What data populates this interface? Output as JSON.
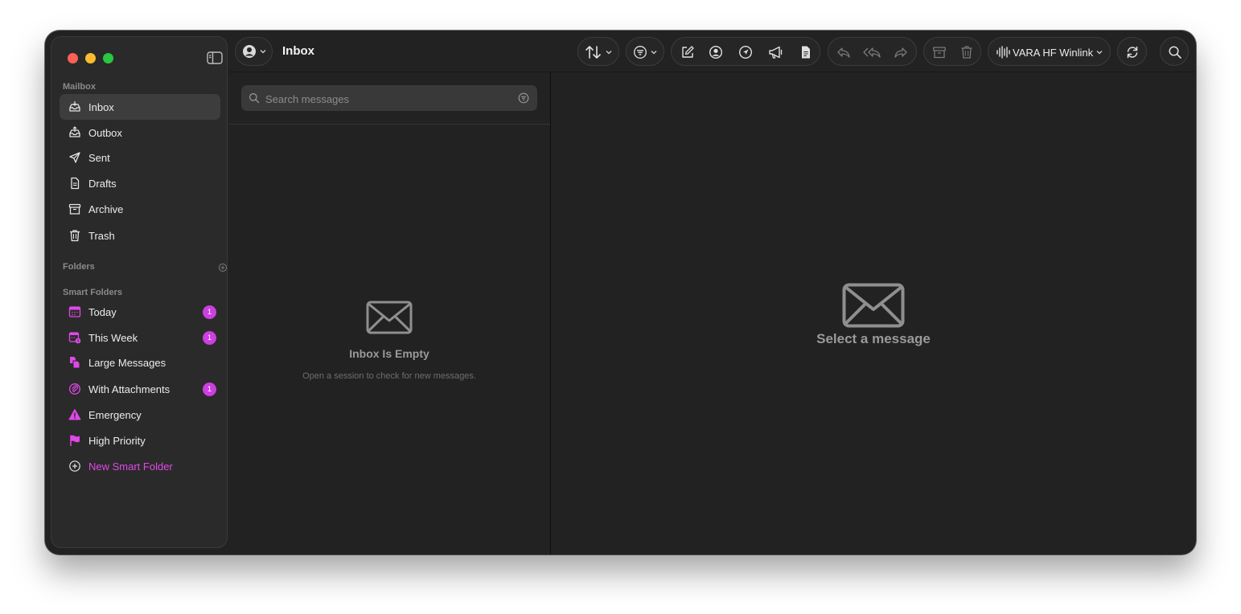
{
  "window": {
    "title": "Inbox",
    "accent_color": "#e048e8",
    "badge_color": "#cc3fe0"
  },
  "sidebar": {
    "mailbox_label": "Mailbox",
    "mailbox_items": [
      {
        "label": "Inbox",
        "icon": "inbox-icon",
        "selected": true
      },
      {
        "label": "Outbox",
        "icon": "outbox-icon"
      },
      {
        "label": "Sent",
        "icon": "paper-plane-icon"
      },
      {
        "label": "Drafts",
        "icon": "document-icon"
      },
      {
        "label": "Archive",
        "icon": "archive-box-icon"
      },
      {
        "label": "Trash",
        "icon": "trash-icon"
      }
    ],
    "folders_label": "Folders",
    "smart_folders_label": "Smart Folders",
    "smart_items": [
      {
        "label": "Today",
        "icon": "calendar-icon",
        "badge": "1"
      },
      {
        "label": "This Week",
        "icon": "calendar-week-icon",
        "badge": "1"
      },
      {
        "label": "Large Messages",
        "icon": "large-docs-icon"
      },
      {
        "label": "With Attachments",
        "icon": "paperclip-icon",
        "badge": "1"
      },
      {
        "label": "Emergency",
        "icon": "warning-triangle-icon"
      },
      {
        "label": "High Priority",
        "icon": "flag-icon"
      },
      {
        "label": "New Smart Folder",
        "icon": "plus-circle-icon"
      }
    ]
  },
  "toolbar": {
    "modem_label": "VARA HF Winlink"
  },
  "list": {
    "search_placeholder": "Search messages",
    "search_value": "",
    "empty_title": "Inbox Is Empty",
    "empty_subtitle": "Open a session to check for new messages."
  },
  "detail": {
    "empty_title": "Select a message"
  }
}
